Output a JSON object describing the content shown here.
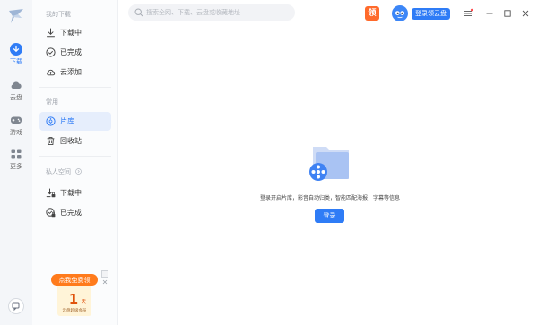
{
  "rail": {
    "items": [
      {
        "label": "下载"
      },
      {
        "label": "云盘"
      },
      {
        "label": "游戏"
      },
      {
        "label": "更多"
      }
    ]
  },
  "sidebar": {
    "my_downloads_title": "我的下载",
    "downloading": "下载中",
    "completed": "已完成",
    "cloud_added": "云添加",
    "common_title": "常用",
    "library": "片库",
    "recycle_bin": "回收站",
    "private_space_title": "私人空间",
    "private_downloading": "下载中",
    "private_completed": "已完成"
  },
  "promo": {
    "banner": "点我免费领",
    "day_number": "1",
    "day_unit": "天",
    "caption": "云盘超级会员"
  },
  "header": {
    "search_placeholder": "搜索全网、下载、云盘或收藏地址",
    "badge_char": "领",
    "login_button": "登录领云盘"
  },
  "main": {
    "empty_message": "登录开启片库，影音自动归类，智能匹配海报，字幕等信息",
    "login_button": "登录"
  },
  "colors": {
    "accent": "#2f7cf6",
    "badge": "#ff6a2b",
    "promo": "#ff7b1c"
  }
}
